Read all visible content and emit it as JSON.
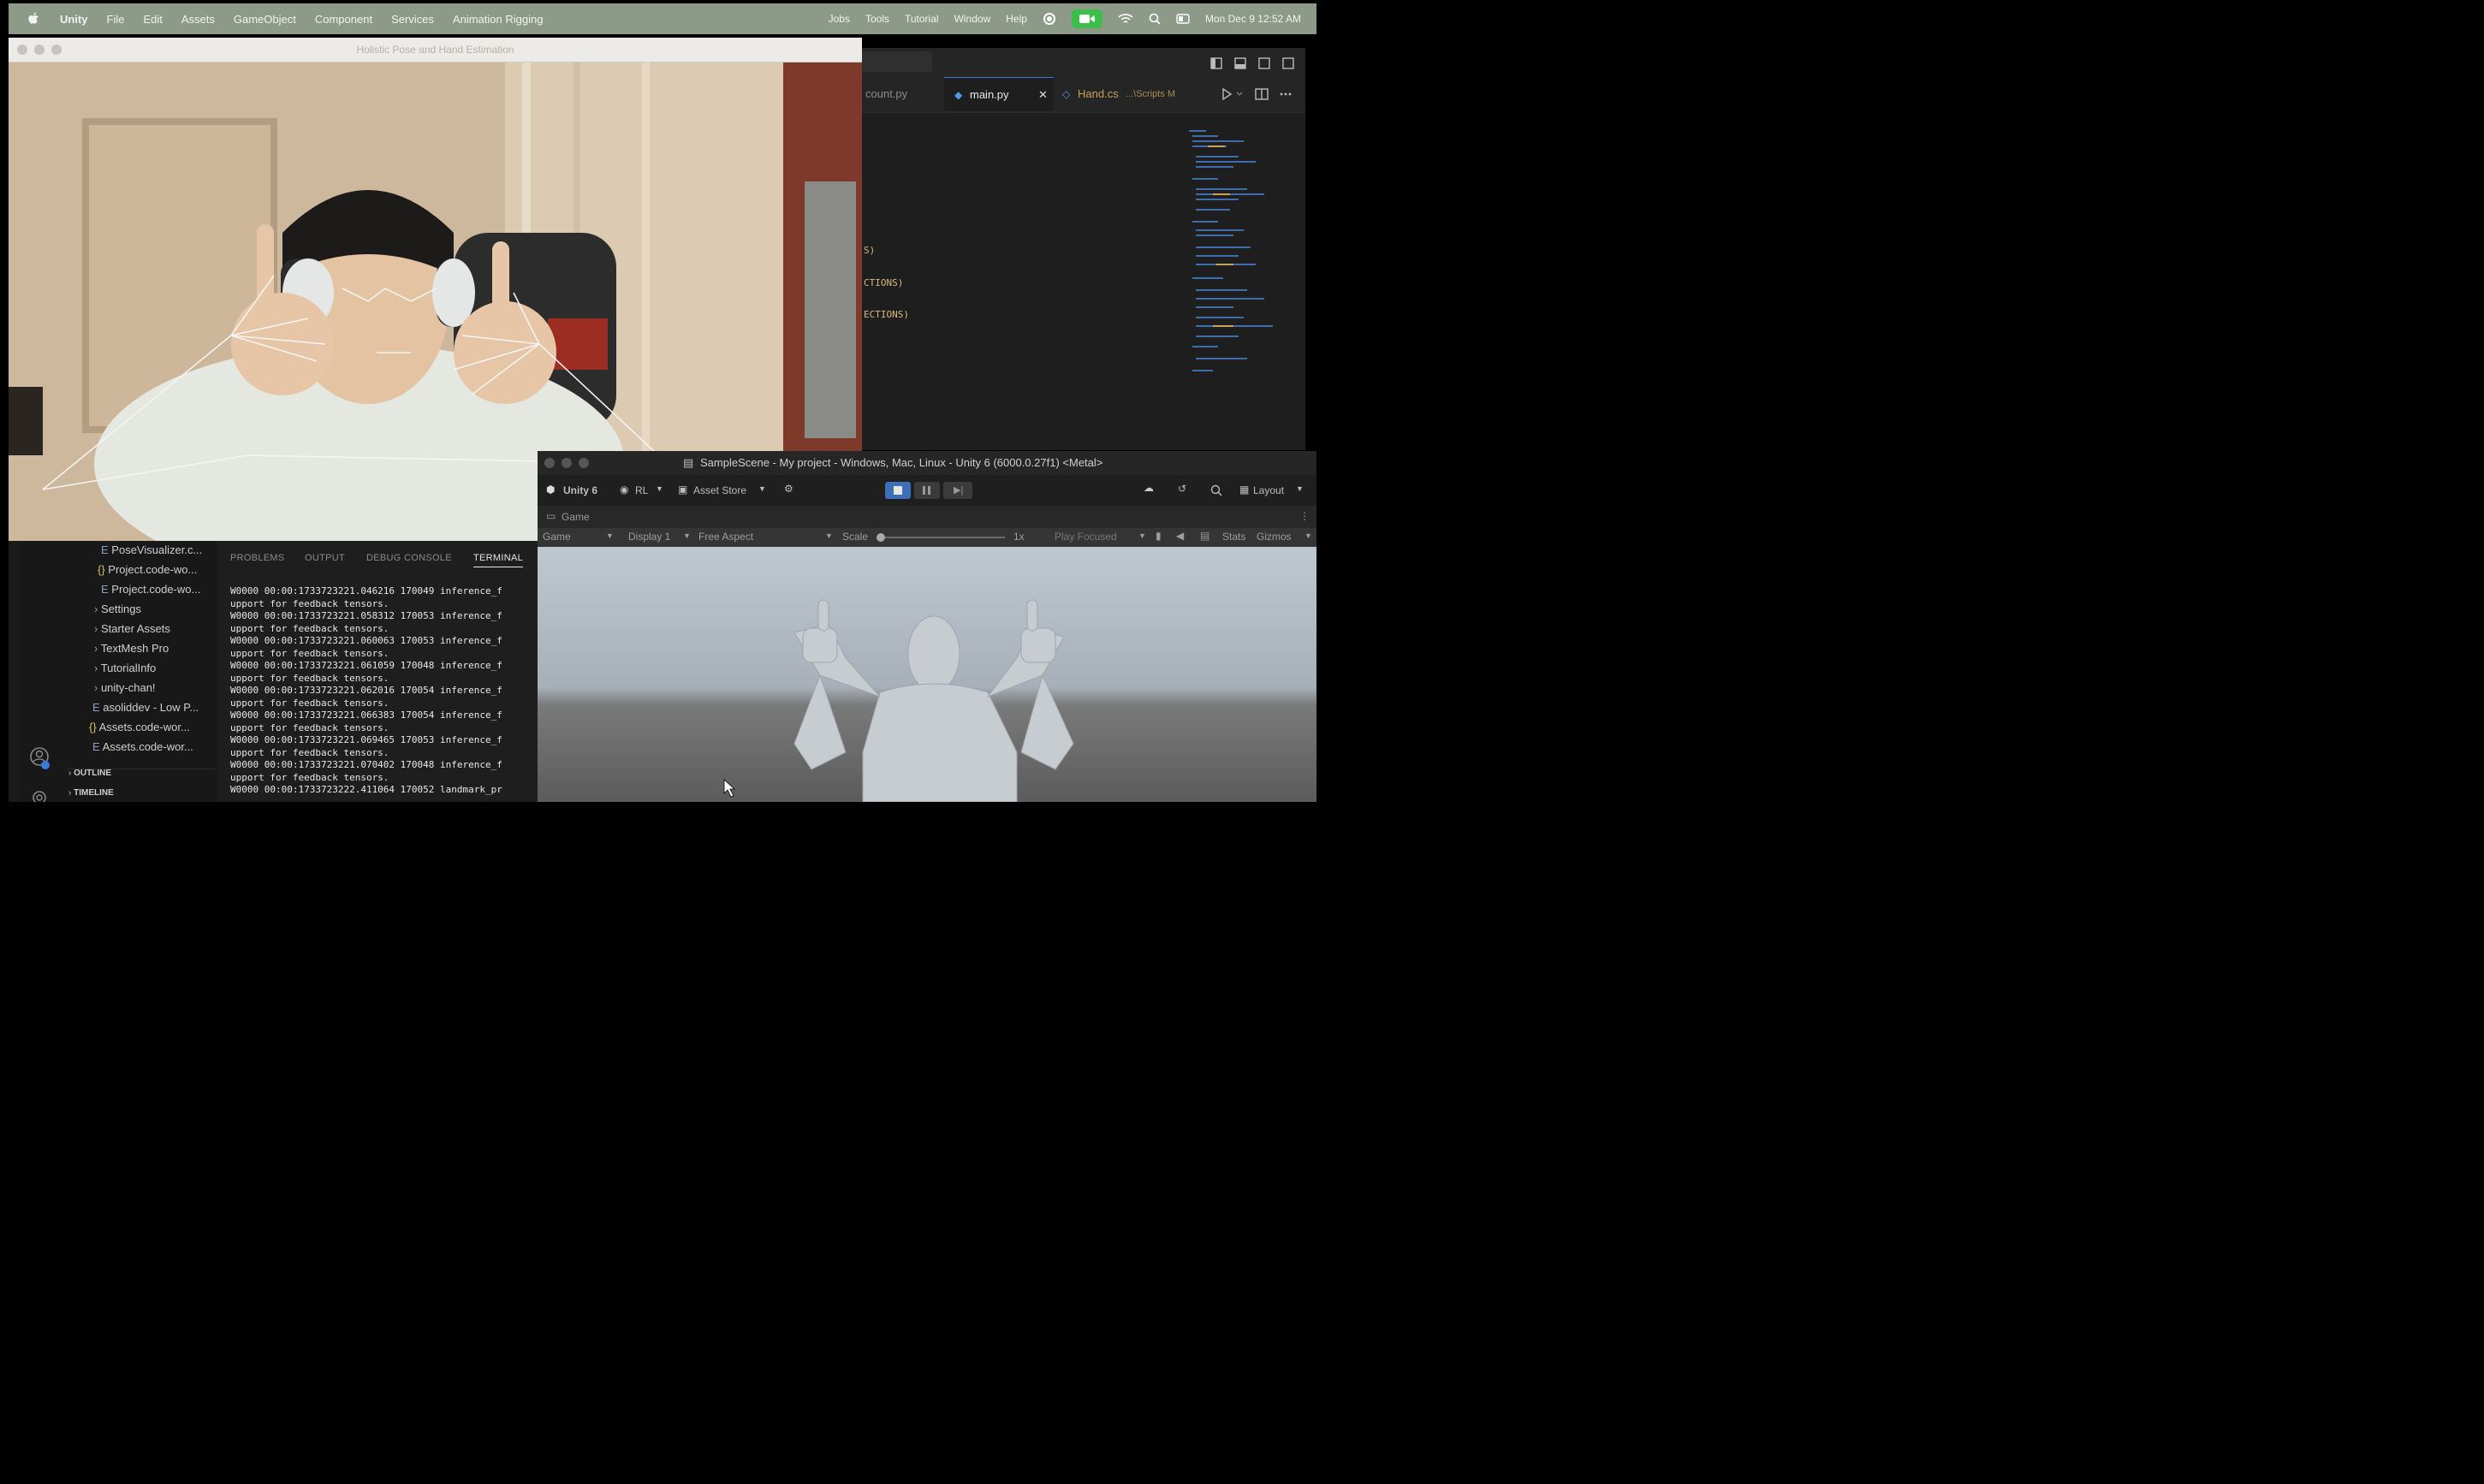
{
  "menubar": {
    "app": "Unity",
    "items": [
      "File",
      "Edit",
      "Assets",
      "GameObject",
      "Component",
      "Services",
      "Animation Rigging"
    ],
    "right_items": [
      "Jobs",
      "Tools",
      "Tutorial",
      "Window",
      "Help"
    ],
    "datetime": "Mon Dec 9  12:52 AM"
  },
  "camera_window": {
    "title": "Holistic Pose and Hand Estimation"
  },
  "editor": {
    "tabs": [
      {
        "label": "count.py"
      },
      {
        "label": "main.py"
      },
      {
        "label": "Hand.cs"
      },
      {
        "label": "...\\Scripts M"
      }
    ],
    "code_fragments": [
      "S)",
      "CTIONS)",
      "ECTIONS)"
    ]
  },
  "explorer": {
    "items": [
      "PoseVisualizer.c...",
      "Project.code-wo...",
      "Project.code-wo...",
      "Settings",
      "Starter Assets",
      "TextMesh Pro",
      "TutorialInfo",
      "unity-chan!",
      "asoliddev - Low P...",
      "Assets.code-wor...",
      "Assets.code-wor..."
    ],
    "sections": [
      "OUTLINE",
      "TIMELINE"
    ]
  },
  "terminal": {
    "tabs": [
      "PROBLEMS",
      "OUTPUT",
      "DEBUG CONSOLE",
      "TERMINAL"
    ],
    "lines": [
      "W0000 00:00:1733723221.046216  170049 inference_f",
      "upport for feedback tensors.",
      "W0000 00:00:1733723221.058312  170053 inference_f",
      "upport for feedback tensors.",
      "W0000 00:00:1733723221.060063  170053 inference_f",
      "upport for feedback tensors.",
      "W0000 00:00:1733723221.061059  170048 inference_f",
      "upport for feedback tensors.",
      "W0000 00:00:1733723221.062016  170054 inference_f",
      "upport for feedback tensors.",
      "W0000 00:00:1733723221.066383  170054 inference_f",
      "upport for feedback tensors.",
      "W0000 00:00:1733723221.069465  170053 inference_f",
      "upport for feedback tensors.",
      "W0000 00:00:1733723221.070402  170048 inference_f",
      "upport for feedback tensors.",
      "W0000 00:00:1733723222.411064  170052 landmark_pr"
    ]
  },
  "unity": {
    "title": "SampleScene - My project - Windows, Mac, Linux - Unity 6 (6000.0.27f1) <Metal>",
    "account": "Unity 6",
    "user": "RL",
    "asset_store": "Asset Store",
    "layout": "Layout",
    "game_tab": "Game",
    "gamebar": {
      "mode": "Game",
      "display": "Display 1",
      "aspect": "Free Aspect",
      "scale_label": "Scale",
      "scale_value": "1x",
      "play_focused": "Play Focused",
      "stats": "Stats",
      "gizmos": "Gizmos"
    }
  }
}
